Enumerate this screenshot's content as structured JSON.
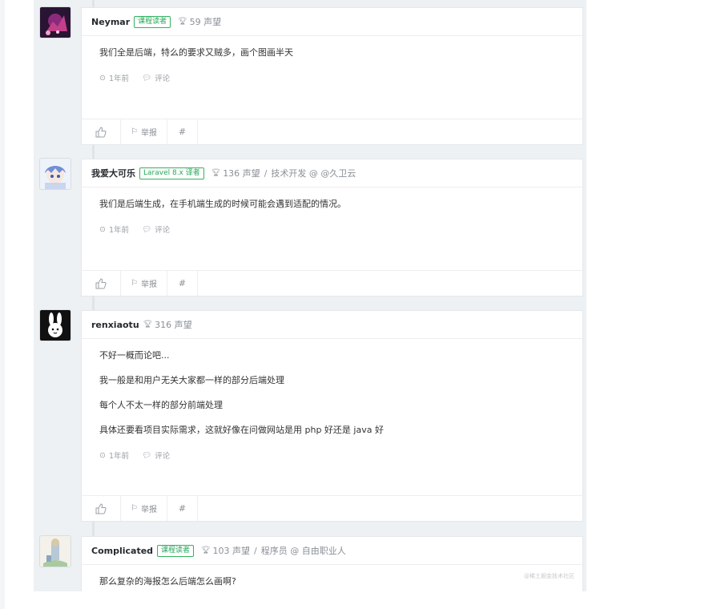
{
  "comments": [
    {
      "username": "Neymar",
      "badge": "课程读者",
      "reputation": "59 声望",
      "job": "",
      "body": [
        "我们全是后端，特么的要求又贼多，画个图画半天"
      ],
      "time": "1年前",
      "reply_label": "评论",
      "report_label": "举报",
      "permalink_label": "#"
    },
    {
      "username": "我爱大可乐",
      "badge": "Laravel 8.x 译者",
      "reputation": "136 声望",
      "job": "技术开发 @ @久卫云",
      "body": [
        "我们是后端生成，在手机端生成的时候可能会遇到适配的情况。"
      ],
      "time": "1年前",
      "reply_label": "评论",
      "report_label": "举报",
      "permalink_label": "#"
    },
    {
      "username": "renxiaotu",
      "badge": "",
      "reputation": "316 声望",
      "job": "",
      "body": [
        "不好一概而论吧...",
        "我一般是和用户无关大家都一样的部分后端处理",
        "每个人不太一样的部分前端处理",
        "具体还要看项目实际需求，这就好像在问做网站是用 php 好还是 java 好"
      ],
      "time": "1年前",
      "reply_label": "评论",
      "report_label": "举报",
      "permalink_label": "#"
    },
    {
      "username": "Complicated",
      "badge": "课程读者",
      "reputation": "103 声望",
      "job": "程序员 @ 自由职业人",
      "body": [
        "那么复杂的海报怎么后端怎么画啊?"
      ],
      "watermark": "@稀土掘金技术社区"
    }
  ],
  "icons": {
    "trophy": "trophy-icon",
    "clock": "clock-icon",
    "comment": "comment-bubble-icon",
    "like": "thumbs-up-icon",
    "flag": "flag-icon"
  },
  "colors": {
    "badge_green": "#28a65a",
    "panel_bg": "#eef1f3",
    "muted_text": "#8a9097"
  }
}
